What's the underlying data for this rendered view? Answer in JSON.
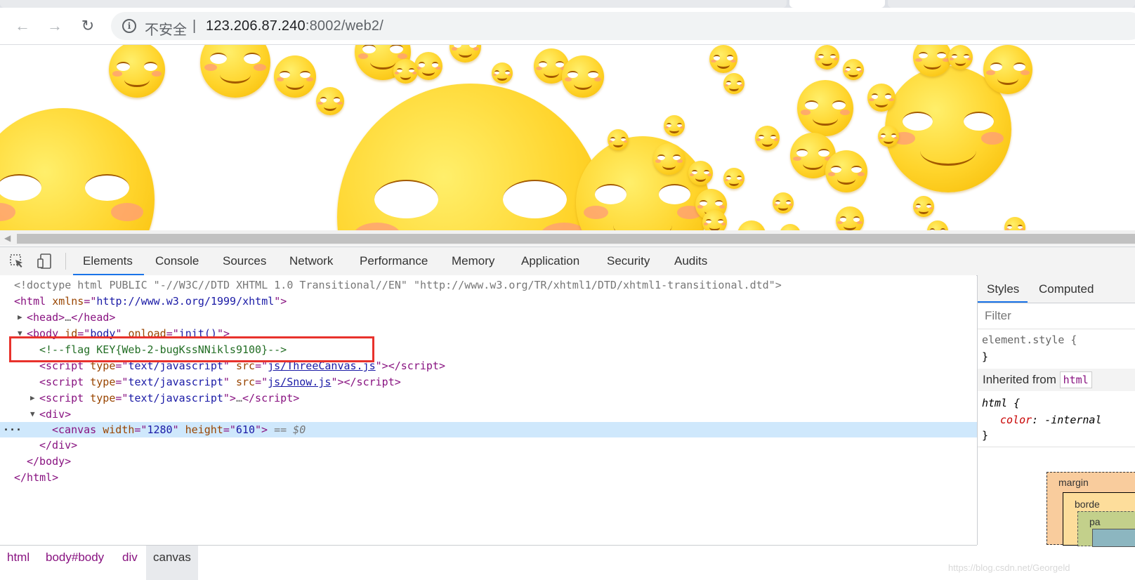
{
  "browser": {
    "address": {
      "security_label": "不安全",
      "separator": "|",
      "host": "123.206.87.240",
      "rest": ":8002/web2/"
    },
    "nav": {
      "back_icon": "←",
      "forward_icon": "→",
      "reload_icon": "↻",
      "info_icon": "i"
    }
  },
  "devtools": {
    "tabs": [
      "Elements",
      "Console",
      "Sources",
      "Network",
      "Performance",
      "Memory",
      "Application",
      "Security",
      "Audits"
    ],
    "active_tab": "Elements",
    "dom": {
      "doctype": "<!doctype html PUBLIC \"-//W3C//DTD XHTML 1.0 Transitional//EN\" \"http://www.w3.org/TR/xhtml1/DTD/xhtml1-transitional.dtd\">",
      "html_ns_value": "http://www.w3.org/1999/xhtml",
      "body_id": "body",
      "body_onload": "init()",
      "comment": "<!--flag KEY{Web-2-bugKssNNikls9100}-->",
      "script_type": "text/javascript",
      "script1_src": "js/ThreeCanvas.js",
      "script2_src": "js/Snow.js",
      "canvas_width": "1280",
      "canvas_height": "610",
      "selected_marker": "== $0"
    },
    "side_panel": {
      "tabs": [
        "Styles",
        "Computed"
      ],
      "filter_placeholder": "Filter",
      "element_style": "element.style {",
      "close_brace": "}",
      "inherited_label": "Inherited from",
      "inherited_tag": "html",
      "html_rule": "html {",
      "color_prop": "color",
      "color_value": "-internal",
      "box_labels": {
        "margin": "margin",
        "border": "borde",
        "padding": "pa"
      }
    },
    "breadcrumbs": [
      "html",
      "body#body",
      "div",
      "canvas"
    ],
    "active_breadcrumb": "canvas",
    "watermark": "https://blog.csdn.net/Georgeld"
  }
}
